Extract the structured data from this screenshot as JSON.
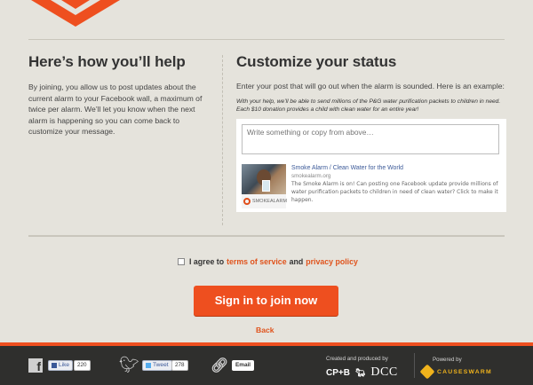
{
  "left": {
    "heading": "Here’s how you’ll help",
    "body": "By joining, you allow us to post updates about the current alarm to your Facebook wall, a maximum of twice per alarm. We’ll let you know when the next alarm is happening so you can come back to customize your message."
  },
  "right": {
    "heading": "Customize your status",
    "intro": "Enter your post that will go out when the alarm is sounded. Here is an example:",
    "example": "With your help, we’ll be able to send millions of the P&G water purification packets to children in need. Each $10 donation provides a child with clean water for an entire year!",
    "placeholder": "Write something or copy from above…",
    "preview": {
      "logo_text": "SMOKEALARM",
      "title": "Smoke Alarm / Clean Water for the World",
      "url": "smokealarm.org",
      "description": "The Smoke Alarm is on! Can posting one Facebook update provide millions of water purification packets to children in need of clean water? Click to make it happen."
    }
  },
  "agree": {
    "prefix": "I agree to",
    "terms": "terms of service",
    "and": "and",
    "privacy": "privacy policy"
  },
  "cta": {
    "label": "Sign in to join now"
  },
  "back": {
    "label": "Back"
  },
  "footer": {
    "like_label": "Like",
    "like_count": "220",
    "tweet_label": "Tweet",
    "tweet_count": "278",
    "email_label": "Email",
    "produced_by": "Created and produced by",
    "cpb": "CP+B",
    "dcc": "DCC",
    "powered_by": "Powered by",
    "causeswarm": "CAUSESWARM"
  },
  "colors": {
    "accent": "#ee4f1f",
    "link": "#e0531c",
    "background": "#e5e3dc",
    "footer": "#2f2f2d"
  }
}
